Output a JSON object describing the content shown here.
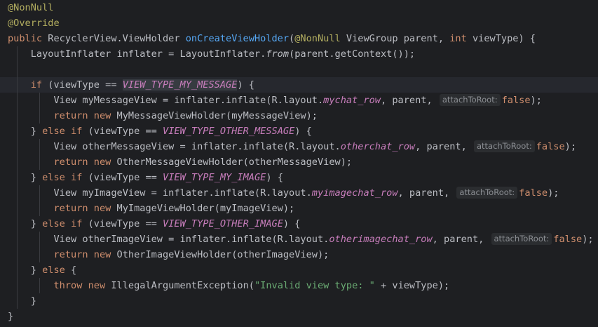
{
  "code": {
    "l1_ann": "@NonNull",
    "l2_ann": "@Override",
    "l3_public": "public",
    "l3_type": " RecyclerView.ViewHolder ",
    "l3_method": "onCreateViewHolder",
    "l3_open": "(",
    "l3_ann": "@NonNull",
    "l3_params1": " ViewGroup parent, ",
    "l3_int": "int",
    "l3_params2": " viewType) {",
    "l4_a": "LayoutInflater inflater = LayoutInflater.",
    "l4_from": "from",
    "l4_b": "(parent.getContext());",
    "l6_if": "if",
    "l6_a": " (viewType == ",
    "l6_const": "VIEW_TYPE_MY_MESSAGE",
    "l6_b": ") {",
    "l7_a": "View myMessageView = inflater.inflate(R.layout.",
    "l7_field": "mychat_row",
    "l7_b": ", parent, ",
    "hint_label": "attachToRoot:",
    "false_kw": "false",
    "close_paren_semi": ");",
    "return_kw": "return",
    "new_kw": "new",
    "l8_b": " MyMessageViewHolder(myMessageView);",
    "else_kw": "else",
    "brace_close": "} ",
    "l9_a": " (viewType == ",
    "l9_const": "VIEW_TYPE_OTHER_MESSAGE",
    "l9_b": ") {",
    "l10_a": "View otherMessageView = inflater.inflate(R.layout.",
    "l10_field": "otherchat_row",
    "l10_b": ", parent, ",
    "l11_b": " OtherMessageViewHolder(otherMessageView);",
    "l12_const": "VIEW_TYPE_MY_IMAGE",
    "l13_a": "View myImageView = inflater.inflate(R.layout.",
    "l13_field": "myimagechat_row",
    "l13_b": ", parent, ",
    "l14_b": " MyImageViewHolder(myImageView);",
    "l15_const": "VIEW_TYPE_OTHER_IMAGE",
    "l16_a": "View otherImageView = inflater.inflate(R.layout.",
    "l16_field": "otherimagechat_row",
    "l16_b": ", parent, ",
    "l17_b": " OtherImageViewHolder(otherImageView);",
    "l18_b": " {",
    "throw_kw": "throw",
    "l19_b": " IllegalArgumentException(",
    "l19_str": "\"Invalid view type: \"",
    "l19_c": " + viewType);",
    "inner_close": "}",
    "outer_close": "}"
  },
  "colors": {
    "background": "#1e1f22",
    "keyword": "#cf8e6d",
    "annotation": "#b3ae60",
    "method": "#56a8f5",
    "constant": "#c77dbb",
    "string": "#6aab73",
    "text": "#bcbec4"
  }
}
